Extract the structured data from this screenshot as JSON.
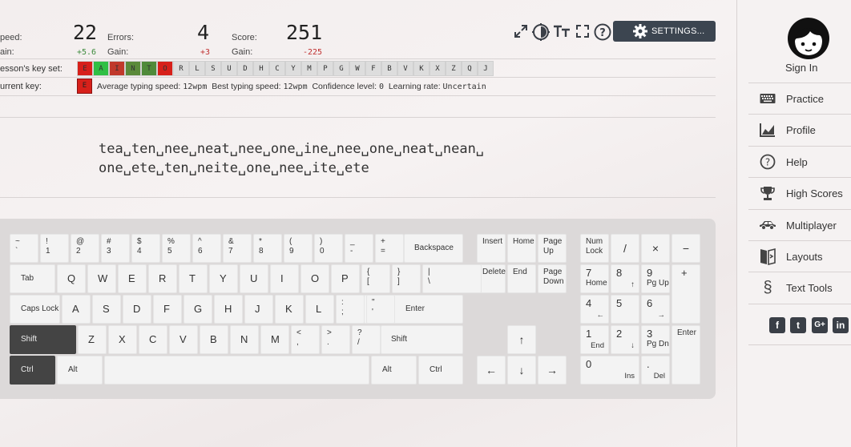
{
  "stats": {
    "speed": {
      "label": "peed:",
      "value": "22",
      "gain_label": "ain:",
      "gain": "+5.6"
    },
    "errors": {
      "label": "Errors:",
      "value": "4",
      "gain_label": "Gain:",
      "gain": "+3"
    },
    "score": {
      "label": "Score:",
      "value": "251",
      "gain_label": "Gain:",
      "gain": "-225"
    }
  },
  "toolbar": {
    "icons": [
      "expand-icon",
      "theme-icon",
      "text-size-icon",
      "fullscreen-icon",
      "help-icon"
    ],
    "settings_label": "SETTINGS..."
  },
  "lesson_keyset": {
    "label": "esson's key set:",
    "keys": [
      {
        "k": "E",
        "color": "#d7201a"
      },
      {
        "k": "A",
        "color": "#2fbf44"
      },
      {
        "k": "I",
        "color": "#c0392b"
      },
      {
        "k": "N",
        "color": "#5b8a3a"
      },
      {
        "k": "T",
        "color": "#4f8a3a"
      },
      {
        "k": "O",
        "color": "#d7201a"
      },
      {
        "k": "R"
      },
      {
        "k": "L"
      },
      {
        "k": "S"
      },
      {
        "k": "U"
      },
      {
        "k": "D"
      },
      {
        "k": "H"
      },
      {
        "k": "C"
      },
      {
        "k": "Y"
      },
      {
        "k": "M"
      },
      {
        "k": "P"
      },
      {
        "k": "G"
      },
      {
        "k": "W"
      },
      {
        "k": "F"
      },
      {
        "k": "B"
      },
      {
        "k": "V"
      },
      {
        "k": "K"
      },
      {
        "k": "X"
      },
      {
        "k": "Z"
      },
      {
        "k": "Q"
      },
      {
        "k": "J"
      }
    ]
  },
  "current_key": {
    "label": "urrent key:",
    "key": "E",
    "avg_label": "Average typing speed:",
    "avg_value": "12wpm",
    "best_label": "Best typing speed:",
    "best_value": "12wpm",
    "conf_label": "Confidence level:",
    "conf_value": "0",
    "rate_label": "Learning rate:",
    "rate_value": "Uncertain"
  },
  "lesson_text": {
    "line1": "tea␣ten␣nee␣neat␣nee␣one␣ine␣nee␣one␣neat␣nean␣",
    "line2": "one␣ete␣ten␣neite␣one␣nee␣ite␣ete"
  },
  "keyboard": {
    "row1": [
      [
        "~",
        "`"
      ],
      [
        "!",
        "1"
      ],
      [
        "@",
        "2"
      ],
      [
        "#",
        "3"
      ],
      [
        "$",
        "4"
      ],
      [
        "%",
        "5"
      ],
      [
        "^",
        "6"
      ],
      [
        "&",
        "7"
      ],
      [
        "*",
        "8"
      ],
      [
        "(",
        "9"
      ],
      [
        ")",
        "0"
      ],
      [
        "_",
        "-"
      ],
      [
        "+",
        "="
      ]
    ],
    "backspace": "Backspace",
    "tab": "Tab",
    "row2": [
      "Q",
      "W",
      "E",
      "R",
      "T",
      "Y",
      "U",
      "I",
      "O",
      "P"
    ],
    "row2_sym": [
      [
        "{",
        "["
      ],
      [
        "}",
        "]"
      ],
      [
        "|",
        "\\"
      ]
    ],
    "caps": "Caps Lock",
    "row3": [
      "A",
      "S",
      "D",
      "F",
      "G",
      "H",
      "J",
      "K",
      "L"
    ],
    "row3_sym": [
      [
        ":",
        ";"
      ],
      [
        "\"",
        "'"
      ]
    ],
    "enter": "Enter",
    "shift": "Shift",
    "row4": [
      "Z",
      "X",
      "C",
      "V",
      "B",
      "N",
      "M"
    ],
    "row4_sym": [
      [
        "<",
        ","
      ],
      [
        ">",
        "."
      ],
      [
        "?",
        "/"
      ]
    ],
    "ctrl": "Ctrl",
    "alt": "Alt",
    "nav": {
      "insert": "Insert",
      "home": "Home",
      "pgup": "Page Up",
      "delete": "Delete",
      "end": "End",
      "pgdn": "Page Down"
    },
    "arrows": {
      "up": "↑",
      "left": "←",
      "down": "↓",
      "right": "→"
    },
    "numpad": {
      "numlock": "Num Lock",
      "div": "/",
      "mul": "×",
      "minus": "−",
      "plus": "+",
      "enter": "Enter",
      "n7": "7",
      "n7s": "Home",
      "n8": "8",
      "n8s": "↑",
      "n9": "9",
      "n9s": "Pg Up",
      "n4": "4",
      "n4s": "←",
      "n5": "5",
      "n6": "6",
      "n6s": "→",
      "n1": "1",
      "n1s": "End",
      "n2": "2",
      "n2s": "↓",
      "n3": "3",
      "n3s": "Pg Dn",
      "n0": "0",
      "n0s": "Ins",
      "dot": ".",
      "dots": "Del"
    }
  },
  "sidebar": {
    "signin": "Sign In",
    "items": [
      {
        "label": "Practice",
        "icon": "keyboard-icon"
      },
      {
        "label": "Profile",
        "icon": "chart-icon"
      },
      {
        "label": "Help",
        "icon": "help-icon"
      },
      {
        "label": "High Scores",
        "icon": "trophy-icon"
      },
      {
        "label": "Multiplayer",
        "icon": "car-icon"
      },
      {
        "label": "Layouts",
        "icon": "layouts-icon"
      },
      {
        "label": "Text Tools",
        "icon": "section-icon"
      }
    ],
    "social": [
      "f",
      "t",
      "G+",
      "in"
    ]
  }
}
